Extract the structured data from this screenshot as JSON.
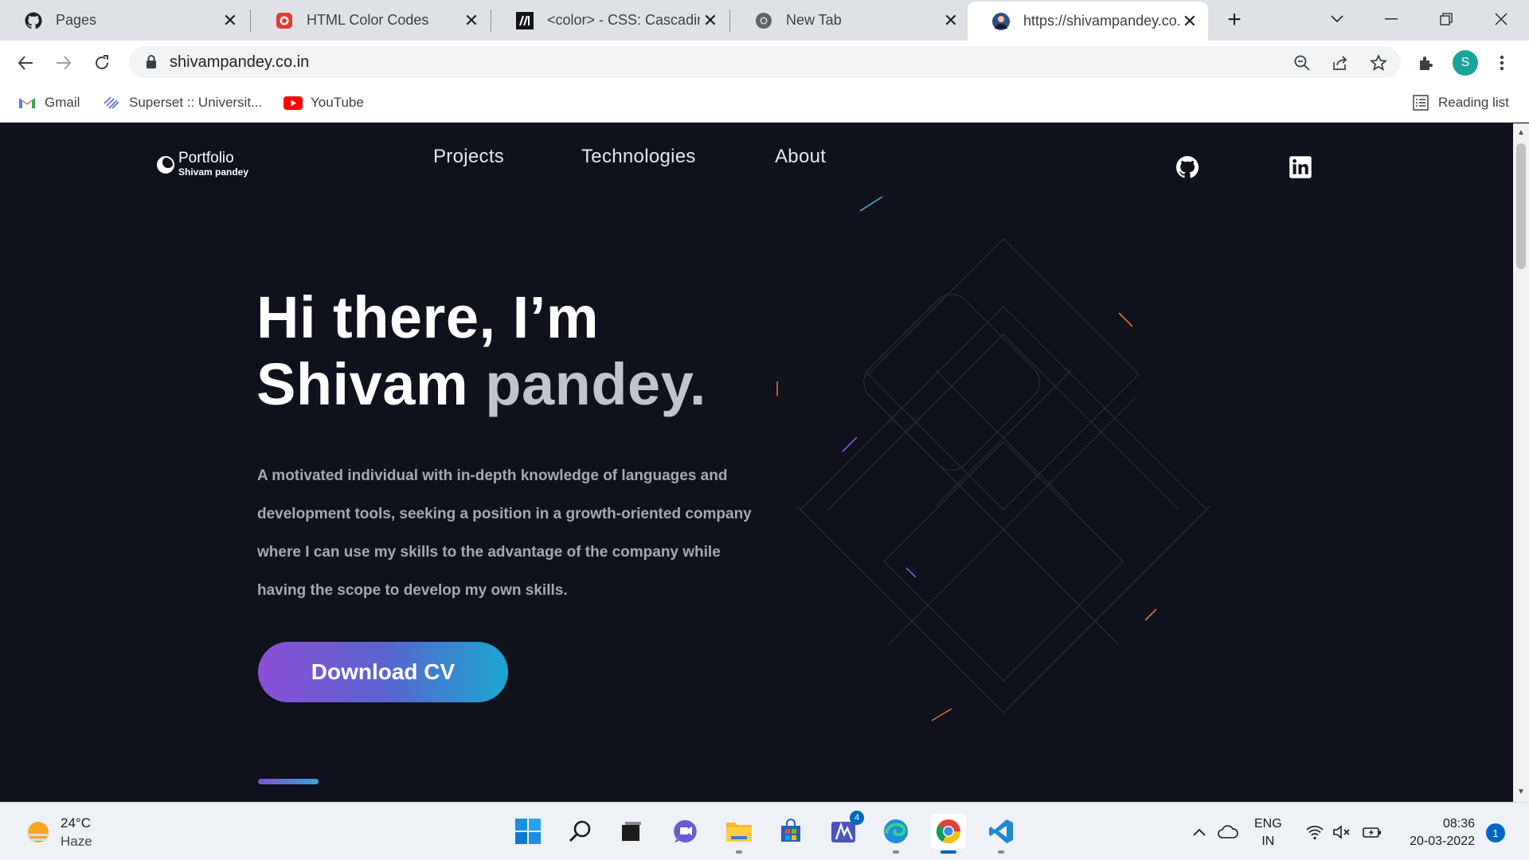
{
  "browser": {
    "tabs": [
      {
        "title": "Pages",
        "icon": "github-icon"
      },
      {
        "title": "HTML Color Codes",
        "icon": "html-color-codes-icon"
      },
      {
        "title": "<color> - CSS: Cascading",
        "icon": "mdn-icon"
      },
      {
        "title": "New Tab",
        "icon": "chrome-icon"
      },
      {
        "title": "https://shivampandey.co.in",
        "icon": "site-avatar-icon",
        "active": true
      }
    ],
    "url": "shivampandey.co.in",
    "profile_initial": "S",
    "bookmarks": [
      {
        "label": "Gmail",
        "icon": "gmail-icon"
      },
      {
        "label": "Superset :: Universit...",
        "icon": "superset-icon"
      },
      {
        "label": "YouTube",
        "icon": "youtube-icon"
      }
    ],
    "reading_list": "Reading list"
  },
  "site": {
    "logo": {
      "title": "Portfolio",
      "subtitle": "Shivam pandey"
    },
    "nav": [
      "Projects",
      "Technologies",
      "About"
    ],
    "hero": {
      "greeting": "Hi there, I’m",
      "name_first": "Shivam ",
      "name_last": "pandey.",
      "description": "A motivated individual with in-depth knowledge of languages and development tools, seeking a position in a growth-oriented company where I can use my skills to the advantage of the company while having the scope to develop my own skills.",
      "cta": "Download CV"
    },
    "colors": {
      "background": "#0f111c",
      "cta_start": "#8d4fd6",
      "cta_end": "#1aa7d0"
    }
  },
  "taskbar": {
    "weather": {
      "temp": "24°C",
      "condition": "Haze"
    },
    "lang": {
      "line1": "ENG",
      "line2": "IN"
    },
    "clock": {
      "time": "08:36",
      "date": "20-03-2022"
    },
    "teams_badge": "4",
    "notifications": "1"
  }
}
